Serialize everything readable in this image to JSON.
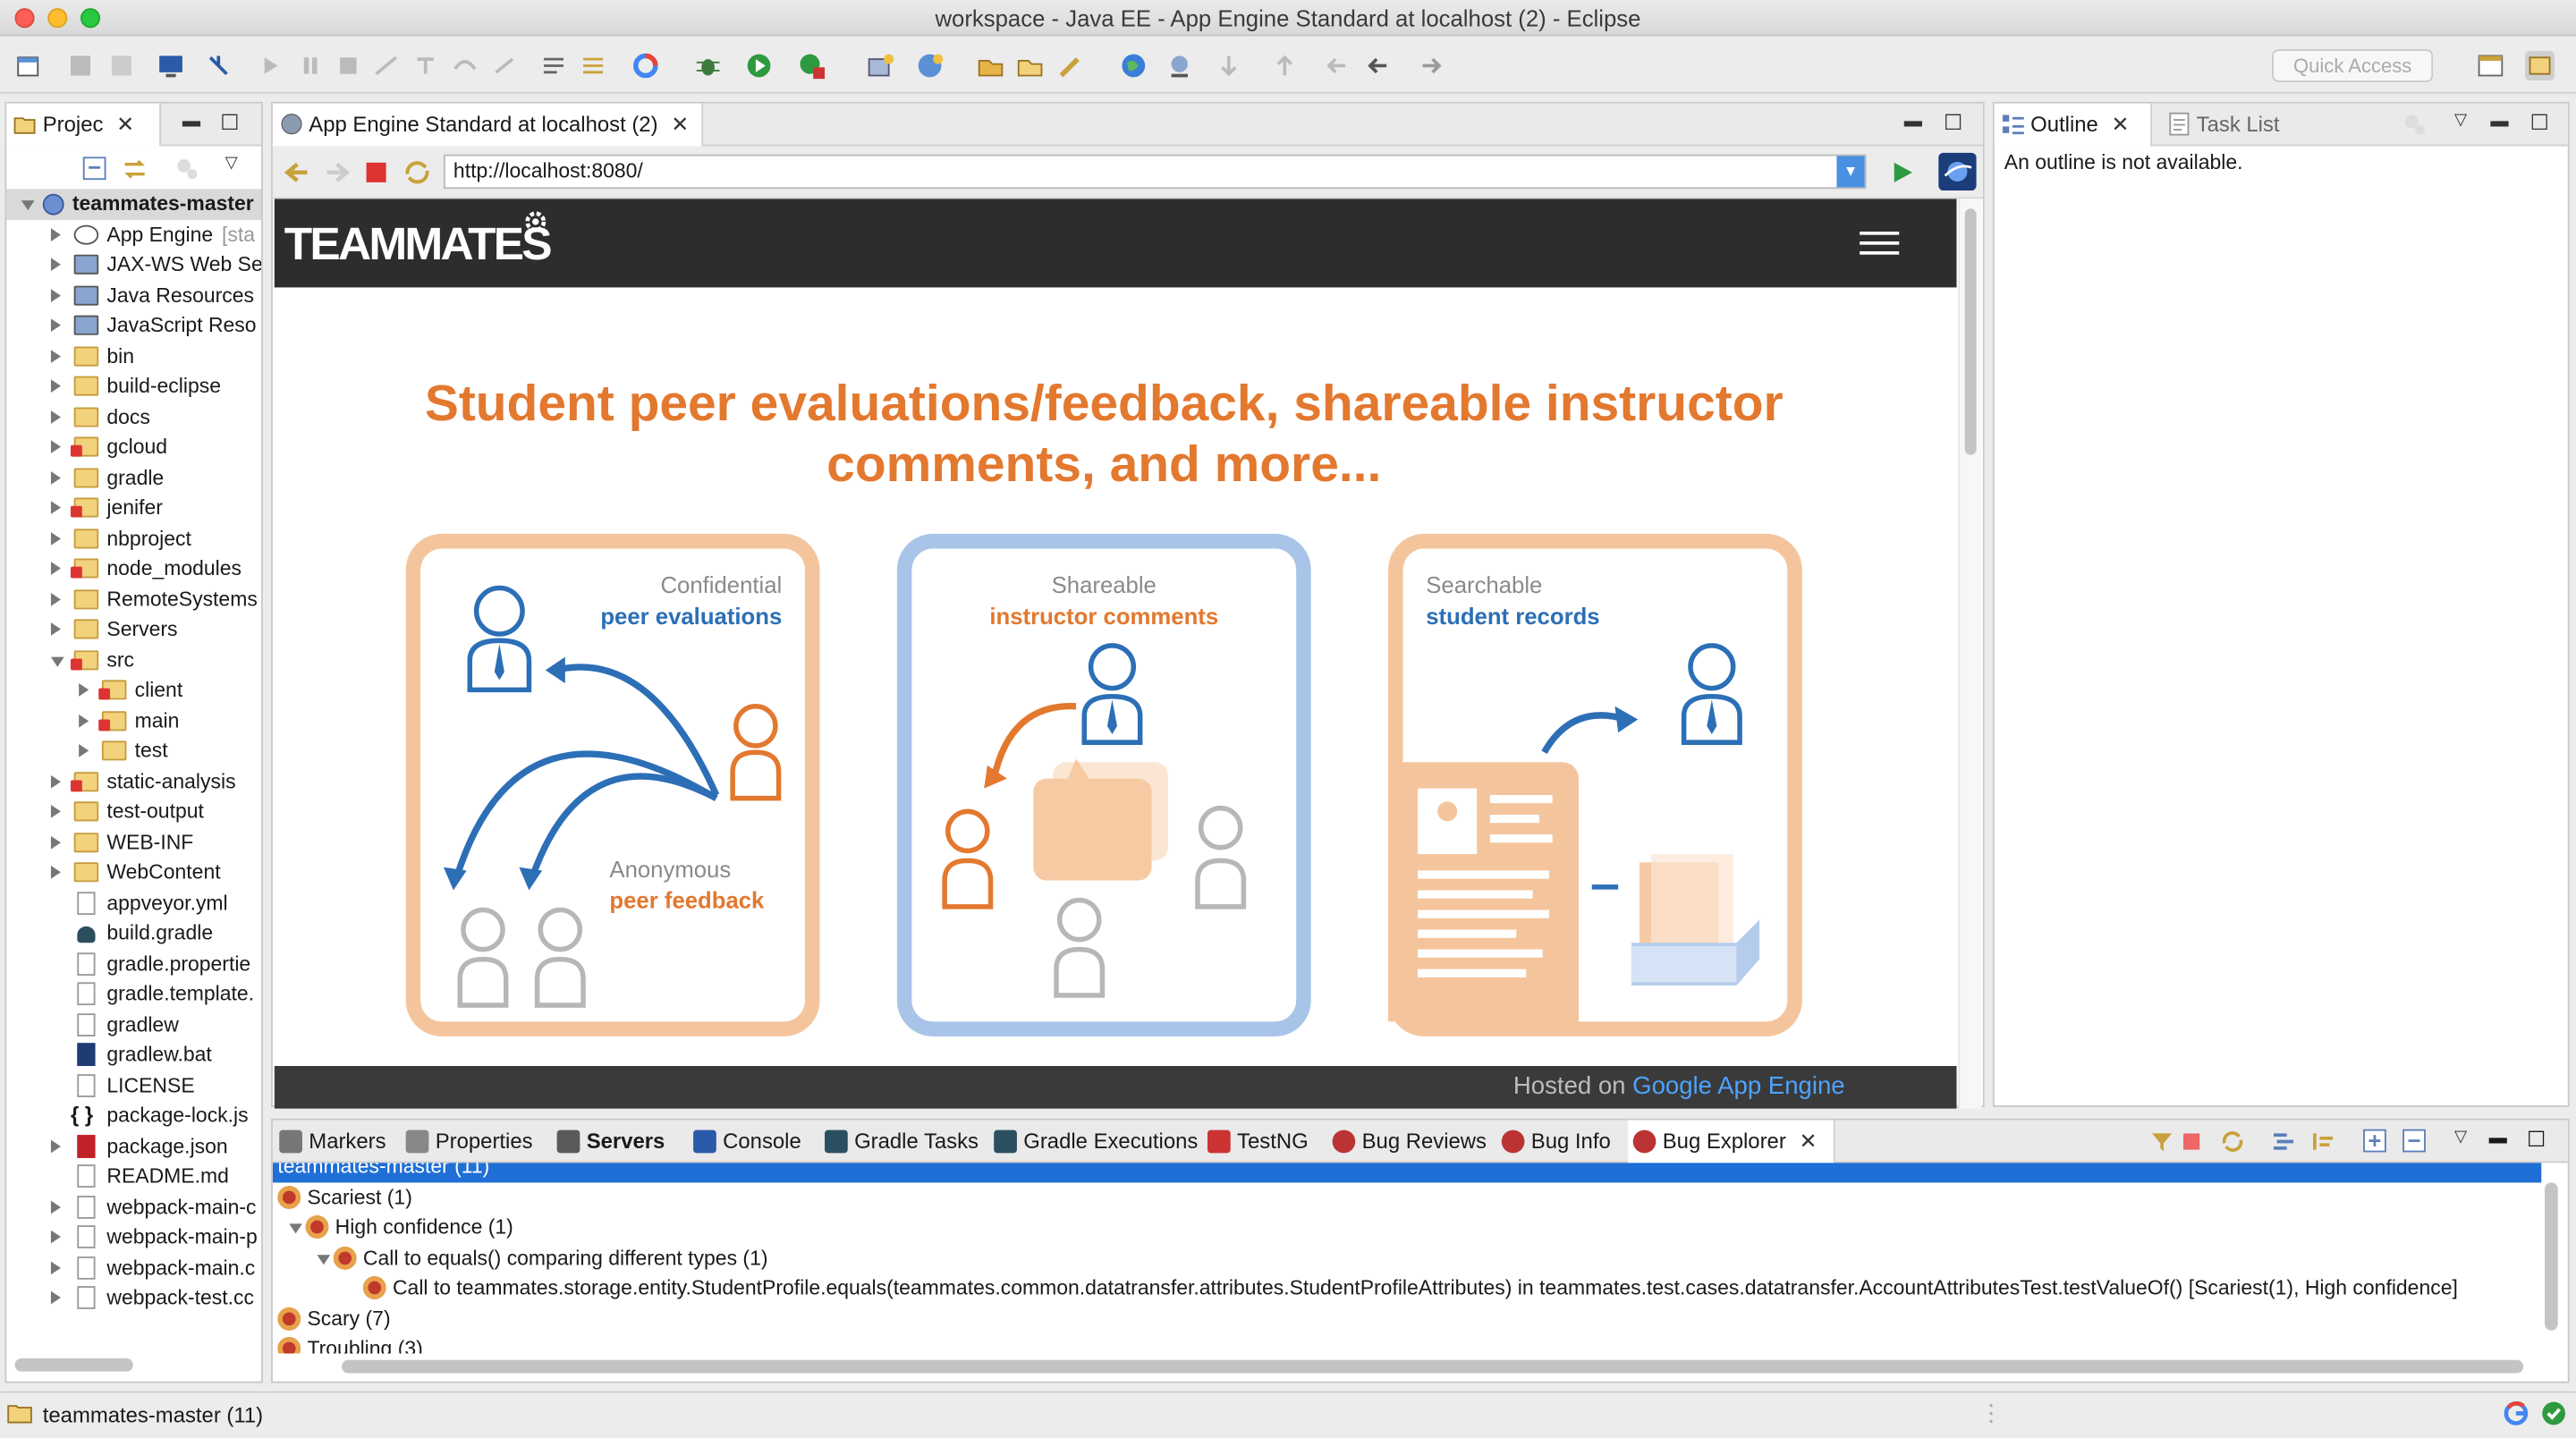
{
  "window": {
    "title": "workspace - Java EE - App Engine Standard at localhost (2) - Eclipse"
  },
  "toolbar": {
    "quick_access": "Quick Access"
  },
  "project_explorer": {
    "tab_label": "Projec",
    "root": "teammates-master",
    "items": [
      {
        "label": "App Engine",
        "suffix": "[sta",
        "icon": "appengine-icon"
      },
      {
        "label": "JAX-WS Web Se",
        "icon": "webservice-icon"
      },
      {
        "label": "Java Resources",
        "icon": "java-resources-icon"
      },
      {
        "label": "JavaScript Reso",
        "icon": "javascript-resources-icon"
      },
      {
        "label": "bin",
        "icon": "folder-icon"
      },
      {
        "label": "build-eclipse",
        "icon": "folder-icon"
      },
      {
        "label": "docs",
        "icon": "folder-icon"
      },
      {
        "label": "gcloud",
        "icon": "folder-error-icon"
      },
      {
        "label": "gradle",
        "icon": "folder-icon"
      },
      {
        "label": "jenifer",
        "icon": "folder-error-icon"
      },
      {
        "label": "nbproject",
        "icon": "folder-icon"
      },
      {
        "label": "node_modules",
        "icon": "folder-error-icon"
      },
      {
        "label": "RemoteSystems",
        "icon": "folder-icon"
      },
      {
        "label": "Servers",
        "icon": "folder-icon"
      },
      {
        "label": "src",
        "icon": "folder-error-icon"
      },
      {
        "label": "client",
        "icon": "folder-error-icon"
      },
      {
        "label": "main",
        "icon": "folder-error-icon"
      },
      {
        "label": "test",
        "icon": "folder-icon"
      },
      {
        "label": "static-analysis",
        "icon": "folder-error-icon"
      },
      {
        "label": "test-output",
        "icon": "folder-icon"
      },
      {
        "label": "WEB-INF",
        "icon": "folder-icon"
      },
      {
        "label": "WebContent",
        "icon": "folder-icon"
      },
      {
        "label": "appveyor.yml",
        "icon": "file-icon"
      },
      {
        "label": "build.gradle",
        "icon": "gradle-icon"
      },
      {
        "label": "gradle.propertie",
        "icon": "file-icon"
      },
      {
        "label": "gradle.template.",
        "icon": "file-icon"
      },
      {
        "label": "gradlew",
        "icon": "file-icon"
      },
      {
        "label": "gradlew.bat",
        "icon": "bat-file-icon"
      },
      {
        "label": "LICENSE",
        "icon": "file-icon"
      },
      {
        "label": "package-lock.js",
        "icon": "json-file-icon"
      },
      {
        "label": "package.json",
        "icon": "npm-icon"
      },
      {
        "label": "README.md",
        "icon": "markdown-icon"
      },
      {
        "label": "webpack-main-c",
        "icon": "file-icon"
      },
      {
        "label": "webpack-main-p",
        "icon": "file-icon"
      },
      {
        "label": "webpack-main.c",
        "icon": "file-icon"
      },
      {
        "label": "webpack-test.cc",
        "icon": "file-icon"
      }
    ]
  },
  "editor": {
    "tab_label": "App Engine Standard at localhost (2)",
    "url": "http://localhost:8080/",
    "page": {
      "logo": "TEAMMATES",
      "headline_line1": "Student peer evaluations/feedback, shareable instructor",
      "headline_line2": "comments, and more...",
      "card1": {
        "line1": "Confidential",
        "line2": "peer evaluations",
        "line3": "Anonymous",
        "line4": "peer feedback"
      },
      "card2": {
        "line1": "Shareable",
        "line2": "instructor comments"
      },
      "card3": {
        "line1": "Searchable",
        "line2": "student records"
      },
      "footer_text": "Hosted on ",
      "footer_link": "Google App Engine"
    }
  },
  "outline": {
    "tab_label": "Outline",
    "task_tab_label": "Task List",
    "message": "An outline is not available."
  },
  "bottom": {
    "tabs": [
      "Markers",
      "Properties",
      "Servers",
      "Console",
      "Gradle Tasks",
      "Gradle Executions",
      "TestNG",
      "Bug Reviews",
      "Bug Info",
      "Bug Explorer"
    ],
    "rows": [
      "teammates-master (11)",
      "Scariest (1)",
      "High confidence (1)",
      "Call to equals() comparing different types (1)",
      "Call to teammates.storage.entity.StudentProfile.equals(teammates.common.datatransfer.attributes.StudentProfileAttributes) in teammates.test.cases.datatransfer.AccountAttributesTest.testValueOf() [Scariest(1), High confidence]",
      "Scary (7)",
      "Troubling (3)"
    ]
  },
  "status": {
    "text": "teammates-master (11)"
  },
  "colors": {
    "accent_orange": "#e3782f",
    "accent_blue": "#2c6fb7",
    "selection": "#1f6fd6"
  }
}
